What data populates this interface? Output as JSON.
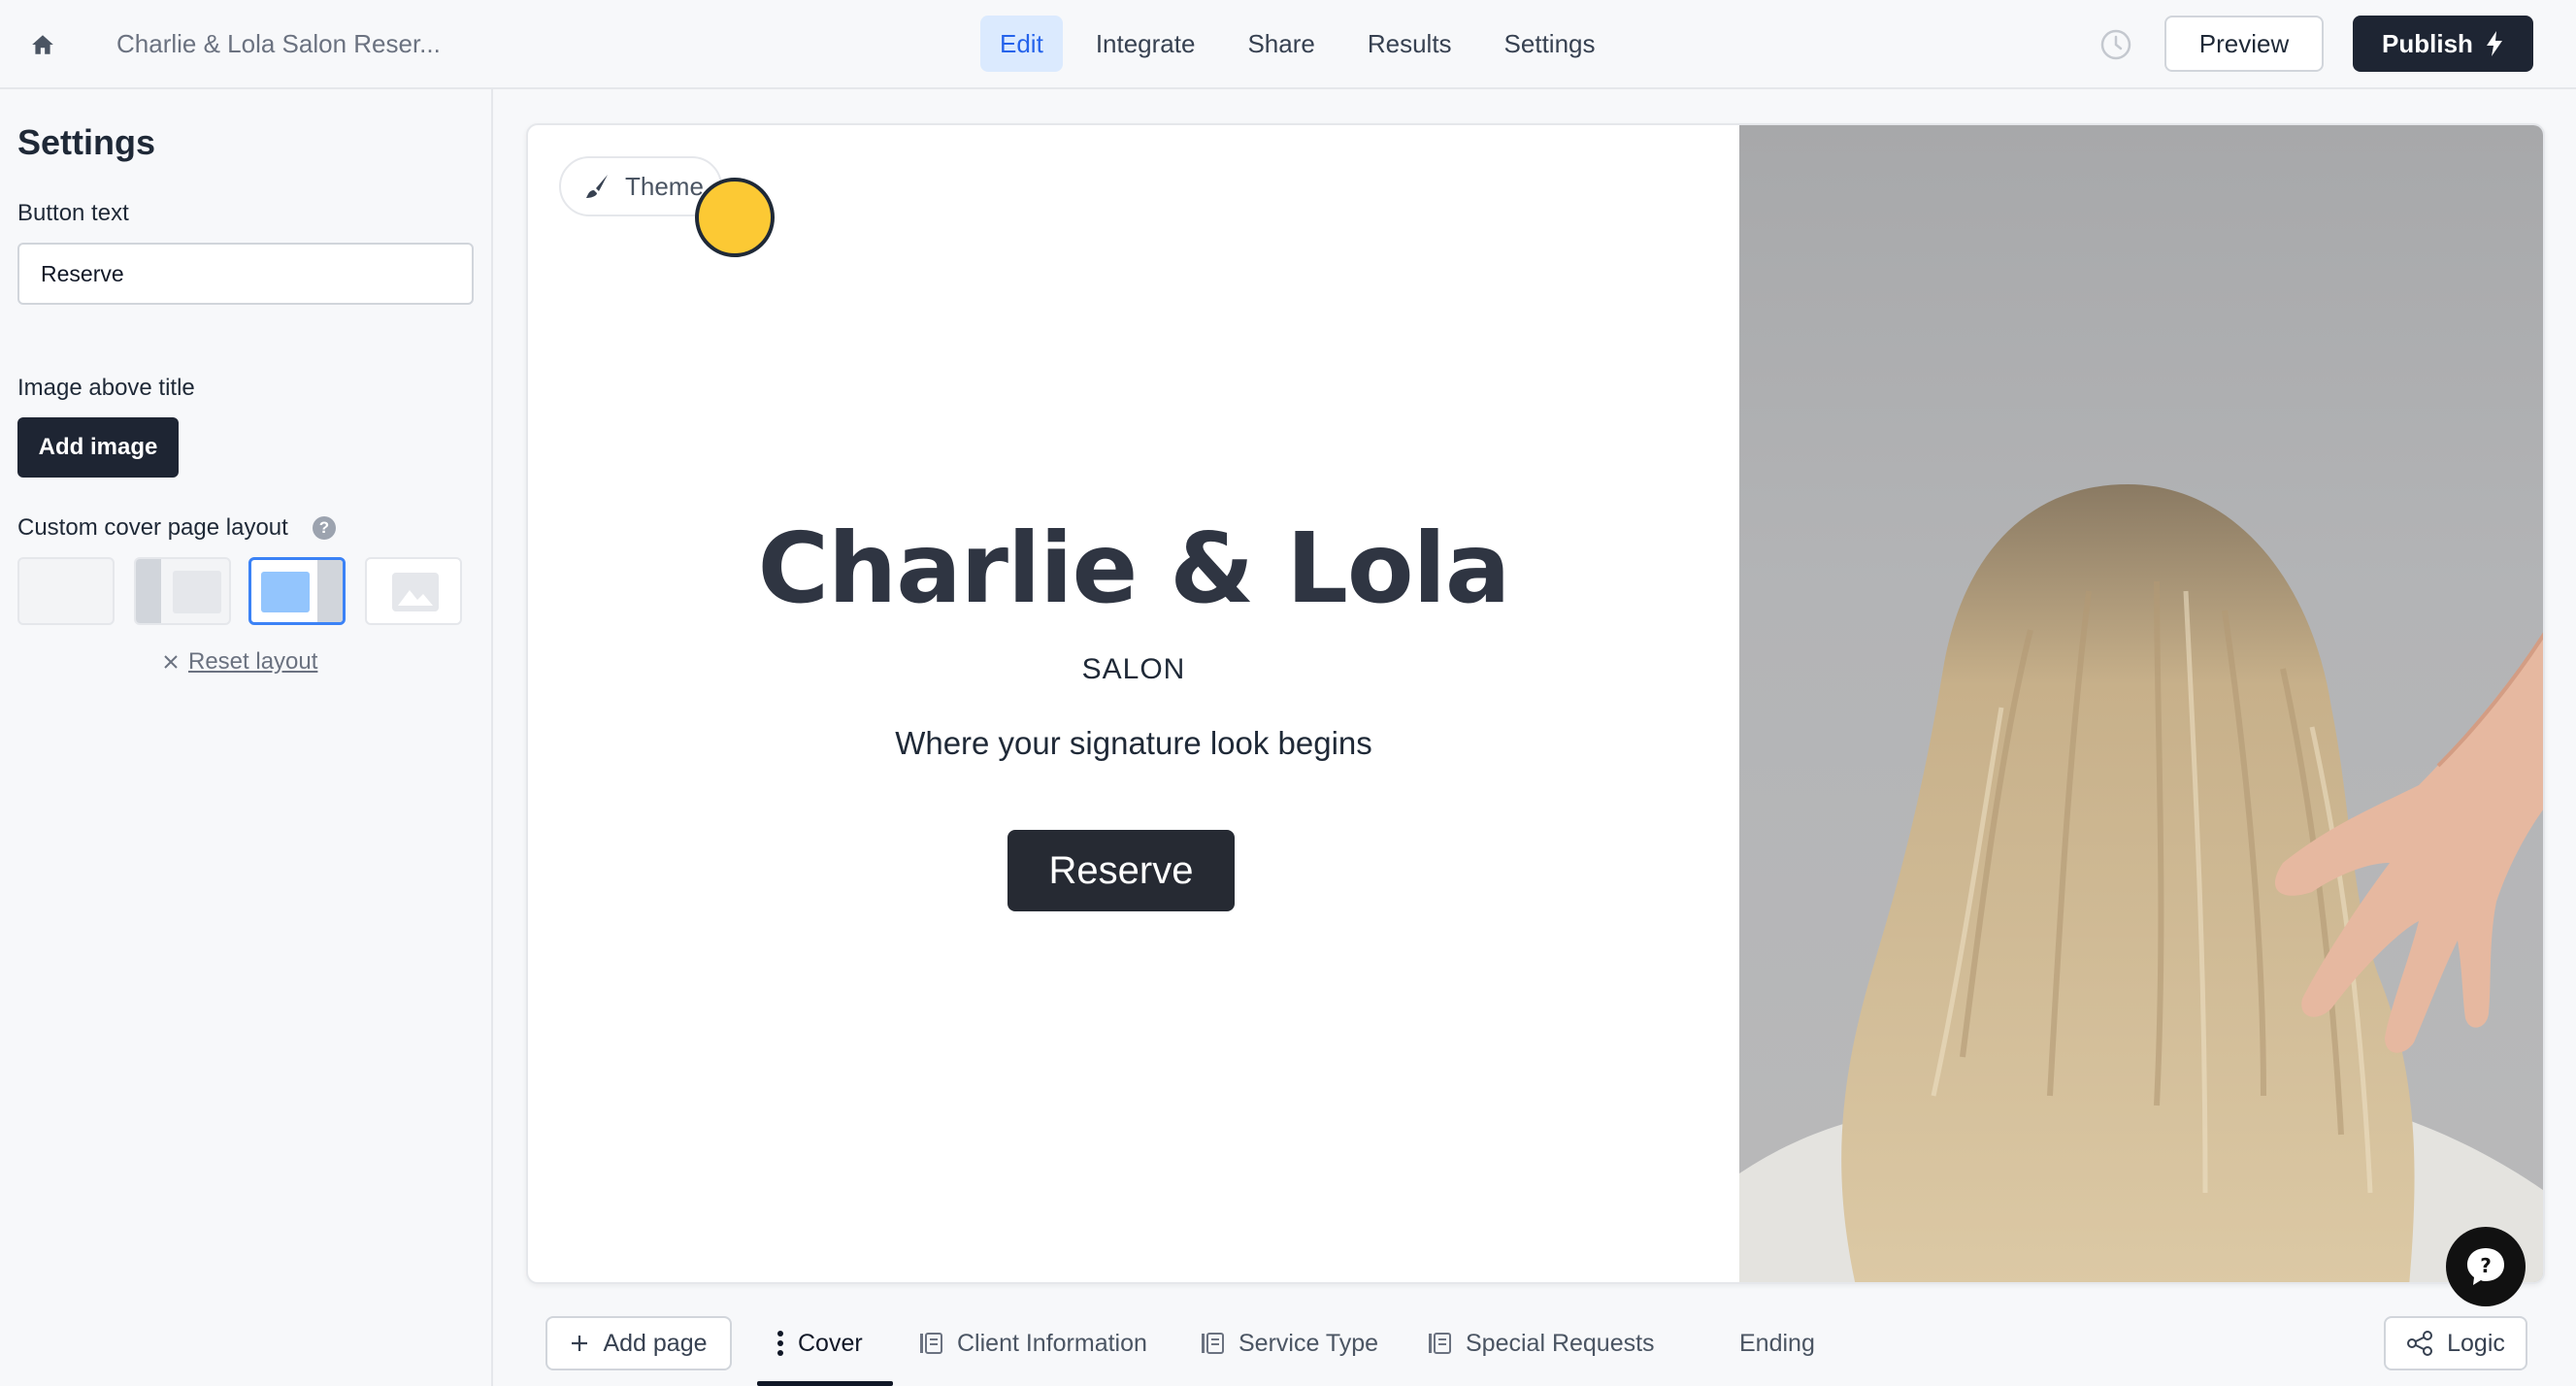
{
  "header": {
    "form_name": "Charlie & Lola Salon Reser...",
    "tabs": [
      {
        "label": "Edit",
        "active": true
      },
      {
        "label": "Integrate",
        "active": false
      },
      {
        "label": "Share",
        "active": false
      },
      {
        "label": "Results",
        "active": false
      },
      {
        "label": "Settings",
        "active": false
      }
    ],
    "preview_label": "Preview",
    "publish_label": "Publish"
  },
  "settings_panel": {
    "title": "Settings",
    "button_text_label": "Button text",
    "button_text_value": "Reserve",
    "image_above_title_label": "Image above title",
    "add_image_label": "Add image",
    "custom_layout_label": "Custom cover page layout",
    "help_glyph": "?",
    "layout_options": [
      {
        "name": "blank",
        "selected": false
      },
      {
        "name": "image-left",
        "selected": false
      },
      {
        "name": "image-right",
        "selected": true
      },
      {
        "name": "image-background",
        "selected": false
      }
    ],
    "reset_layout_label": "Reset layout"
  },
  "cover": {
    "theme_label": "Theme",
    "title": "Charlie & Lola",
    "subtitle": "SALON",
    "tagline": "Where your signature look begins",
    "button_label": "Reserve"
  },
  "pages_bar": {
    "add_page_label": "Add page",
    "pages": [
      {
        "label": "Cover",
        "active": true
      },
      {
        "label": "Client Information",
        "active": false
      },
      {
        "label": "Service Type",
        "active": false
      },
      {
        "label": "Special Requests",
        "active": false
      },
      {
        "label": "Ending",
        "active": false
      }
    ],
    "logic_label": "Logic"
  },
  "colors": {
    "accent": "#2563eb",
    "dark": "#1e2533",
    "cursor_highlight": "#fcc934"
  }
}
